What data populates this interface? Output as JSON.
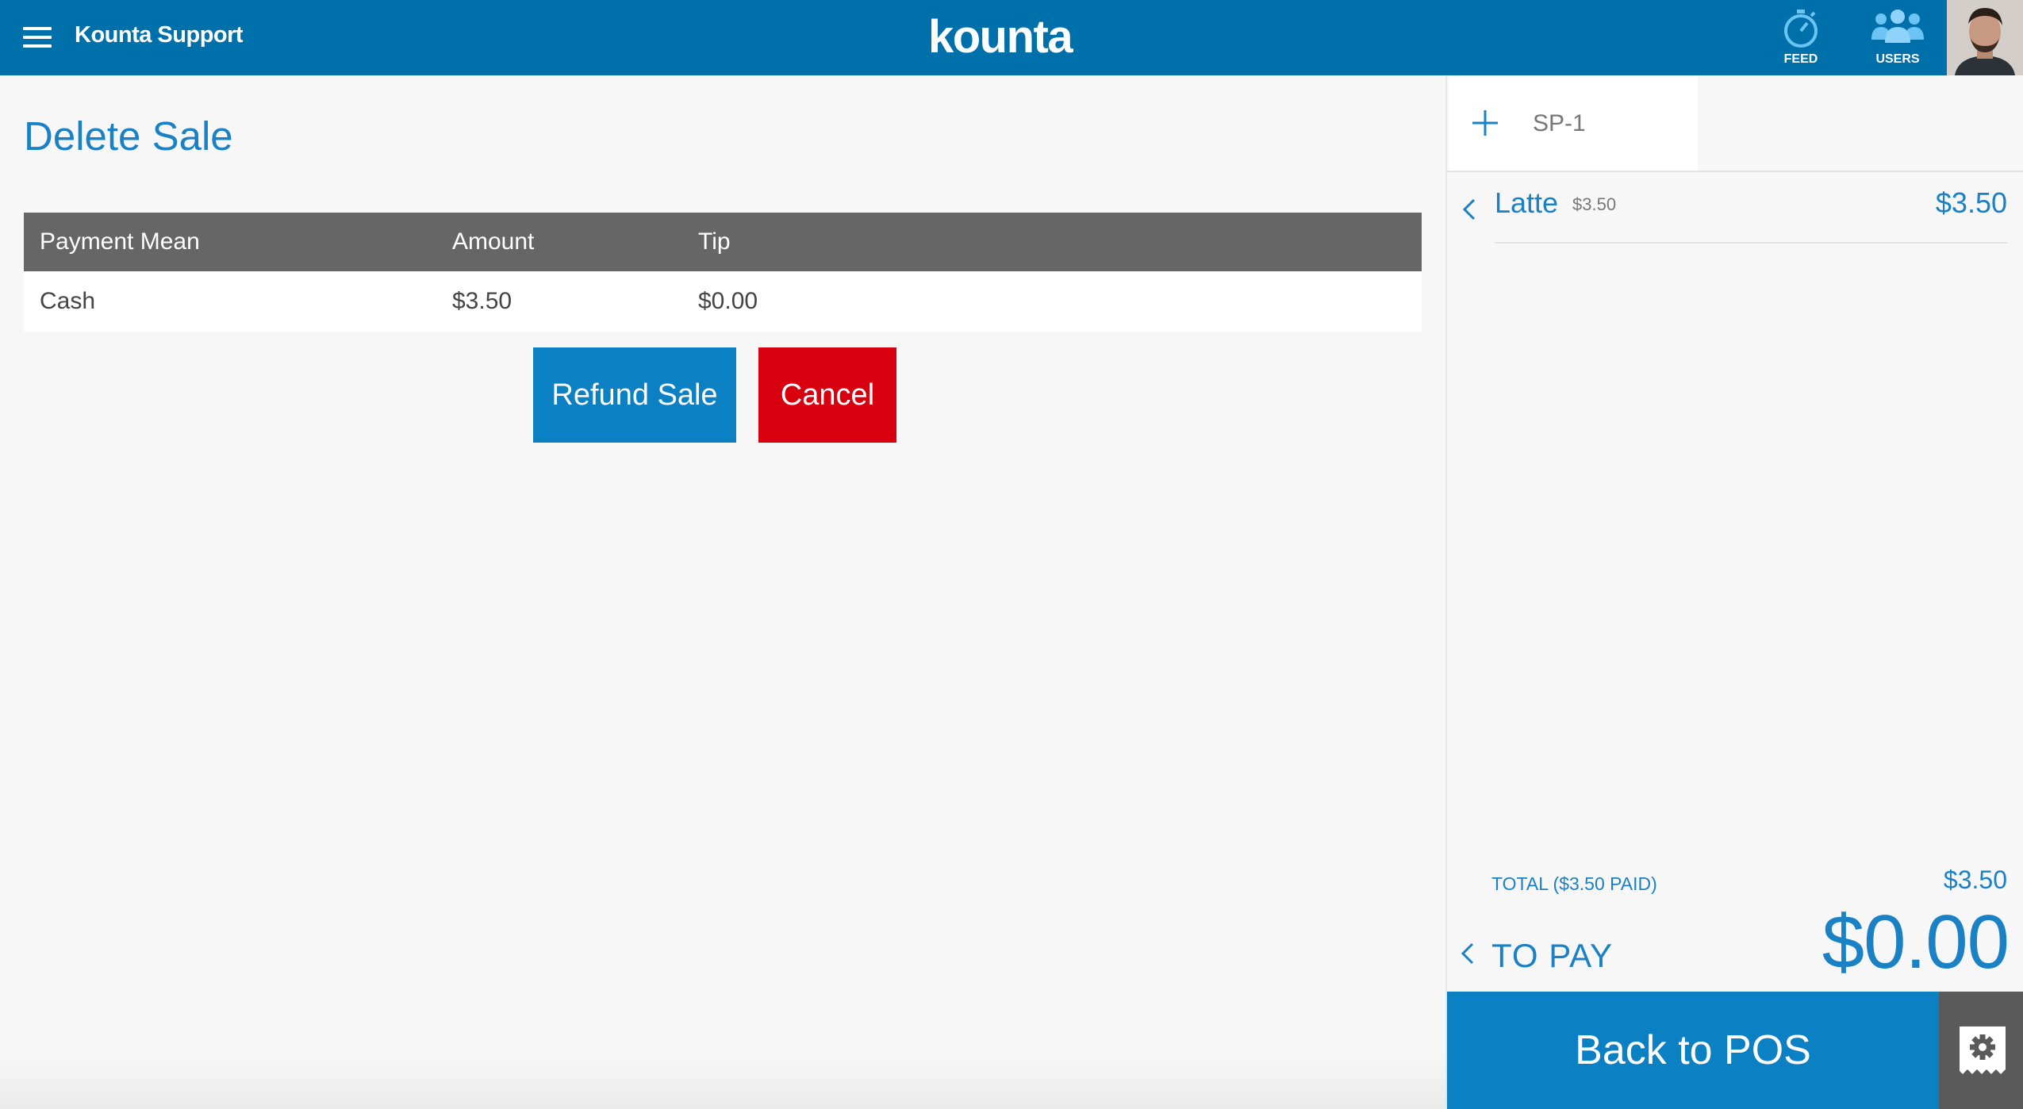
{
  "header": {
    "store_name": "Kounta Support",
    "logo_text": "kounta",
    "feed_label": "FEED",
    "users_label": "USERS"
  },
  "main": {
    "title": "Delete Sale",
    "table": {
      "columns": [
        "Payment Mean",
        "Amount",
        "Tip"
      ],
      "rows": [
        {
          "payment_mean": "Cash",
          "amount": "$3.50",
          "tip": "$0.00"
        }
      ]
    },
    "refund_label": "Refund Sale",
    "cancel_label": "Cancel"
  },
  "sale_panel": {
    "sale_id": "SP-1",
    "items": [
      {
        "name": "Latte",
        "unit_price": "$3.50",
        "line_total": "$3.50"
      }
    ],
    "total_label": "TOTAL ($3.50 PAID)",
    "total_value": "$3.50",
    "to_pay_label": "TO PAY",
    "to_pay_value": "$0.00",
    "back_label": "Back to POS"
  },
  "colors": {
    "primary_blue": "#0070ab",
    "button_blue": "#0b80c3",
    "cancel_red": "#d8000f",
    "header_gray": "#666666",
    "logo_accent": "#ff8a1f"
  },
  "icons": [
    "menu-icon",
    "stopwatch-icon",
    "users-icon",
    "plus-icon",
    "chevron-left-icon",
    "gear-icon"
  ]
}
